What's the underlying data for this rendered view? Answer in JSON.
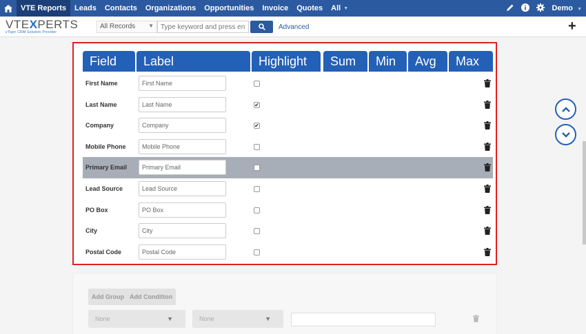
{
  "nav": {
    "items": [
      {
        "label": "VTE Reports",
        "active": true
      },
      {
        "label": "Leads"
      },
      {
        "label": "Contacts"
      },
      {
        "label": "Organizations"
      },
      {
        "label": "Opportunities"
      },
      {
        "label": "Invoice"
      },
      {
        "label": "Quotes"
      },
      {
        "label": "All"
      }
    ],
    "user": "Demo",
    "icons": [
      "home-icon",
      "pencil-icon",
      "info-icon",
      "gear-icon"
    ],
    "bar_color": "#2c5aa0"
  },
  "logo": {
    "text_left": "VTE",
    "text_x": "X",
    "text_right": "PERTS",
    "tagline": "vTiger CRM Solution Provider"
  },
  "search": {
    "records_label": "All Records",
    "placeholder": "Type keyword and press enter",
    "advanced_label": "Advanced"
  },
  "add_label": "+",
  "table": {
    "columns": [
      "Field",
      "Label",
      "Highlight",
      "Sum",
      "Min",
      "Avg",
      "Max"
    ],
    "header_color": "#2360b8",
    "rows": [
      {
        "field": "First Name",
        "label": "First Name",
        "highlight": false
      },
      {
        "field": "Last Name",
        "label": "Last Name",
        "highlight": true
      },
      {
        "field": "Company",
        "label": "Company",
        "highlight": true
      },
      {
        "field": "Mobile Phone",
        "label": "Mobile Phone",
        "highlight": false
      },
      {
        "field": "Primary Email",
        "label": "Primary Email",
        "highlight": false,
        "selected": true
      },
      {
        "field": "Lead Source",
        "label": "Lead Source",
        "highlight": false
      },
      {
        "field": "PO Box",
        "label": "PO Box",
        "highlight": false
      },
      {
        "field": "City",
        "label": "City",
        "highlight": false
      },
      {
        "field": "Postal Code",
        "label": "Postal Code",
        "highlight": false
      }
    ]
  },
  "conditions": {
    "add_group": "Add Group",
    "add_condition": "Add Condition",
    "select1": "None",
    "select2": "None"
  }
}
